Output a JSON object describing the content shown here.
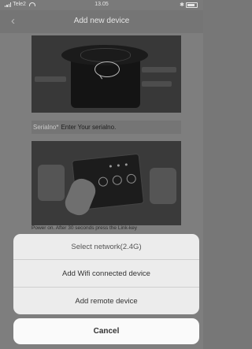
{
  "status_bar": {
    "carrier": "Tele2",
    "time": "13.05",
    "bluetooth": "✱"
  },
  "nav": {
    "title": "Add new device",
    "back_icon": "‹"
  },
  "serial_field": {
    "label": "Serialno*",
    "value": "Enter Your serialno."
  },
  "instructions": "Power on. After 30 seconds press the Link-key",
  "action_sheet": {
    "title": "Select network(2.4G)",
    "options": [
      "Add Wifi connected device",
      "Add remote device"
    ],
    "cancel": "Cancel"
  },
  "icons": {
    "wifi": "wifi-icon",
    "signal": "signal-icon",
    "battery": "battery-icon",
    "back": "chevron-left-icon"
  }
}
